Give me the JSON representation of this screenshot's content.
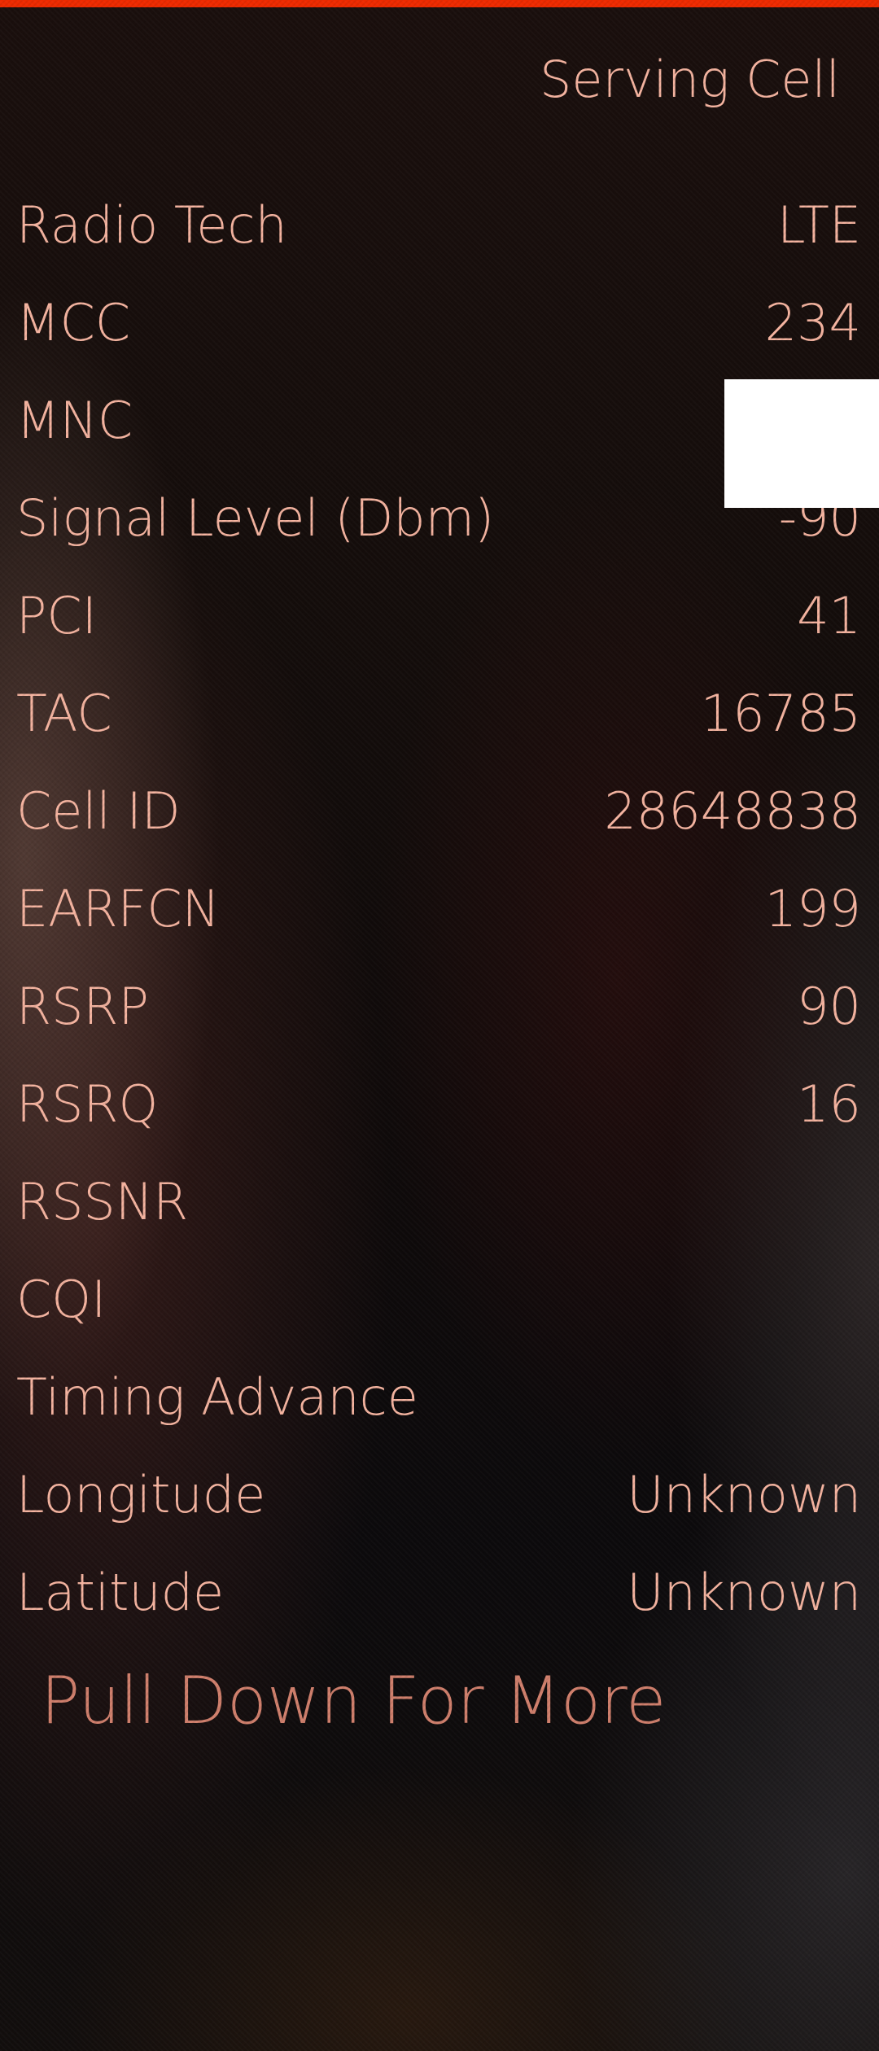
{
  "theme": {
    "accent": "#ee2a00",
    "text": "#f5b4a0",
    "hint": "#d07f6c"
  },
  "header": {
    "title": "Serving Cell"
  },
  "rows": [
    {
      "label": "Radio Tech",
      "value": "LTE"
    },
    {
      "label": "MCC",
      "value": "234"
    },
    {
      "label": "MNC",
      "value": ""
    },
    {
      "label": "Signal Level (Dbm)",
      "value": "-90"
    },
    {
      "label": "PCI",
      "value": "41"
    },
    {
      "label": "TAC",
      "value": "16785"
    },
    {
      "label": "Cell ID",
      "value": "28648838"
    },
    {
      "label": "EARFCN",
      "value": "199"
    },
    {
      "label": "RSRP",
      "value": "90"
    },
    {
      "label": "RSRQ",
      "value": "16"
    },
    {
      "label": "RSSNR",
      "value": ""
    },
    {
      "label": "CQI",
      "value": ""
    },
    {
      "label": "Timing Advance",
      "value": ""
    },
    {
      "label": "Longitude",
      "value": "Unknown"
    },
    {
      "label": "Latitude",
      "value": "Unknown"
    }
  ],
  "footer": {
    "hint": "Pull Down For More"
  }
}
